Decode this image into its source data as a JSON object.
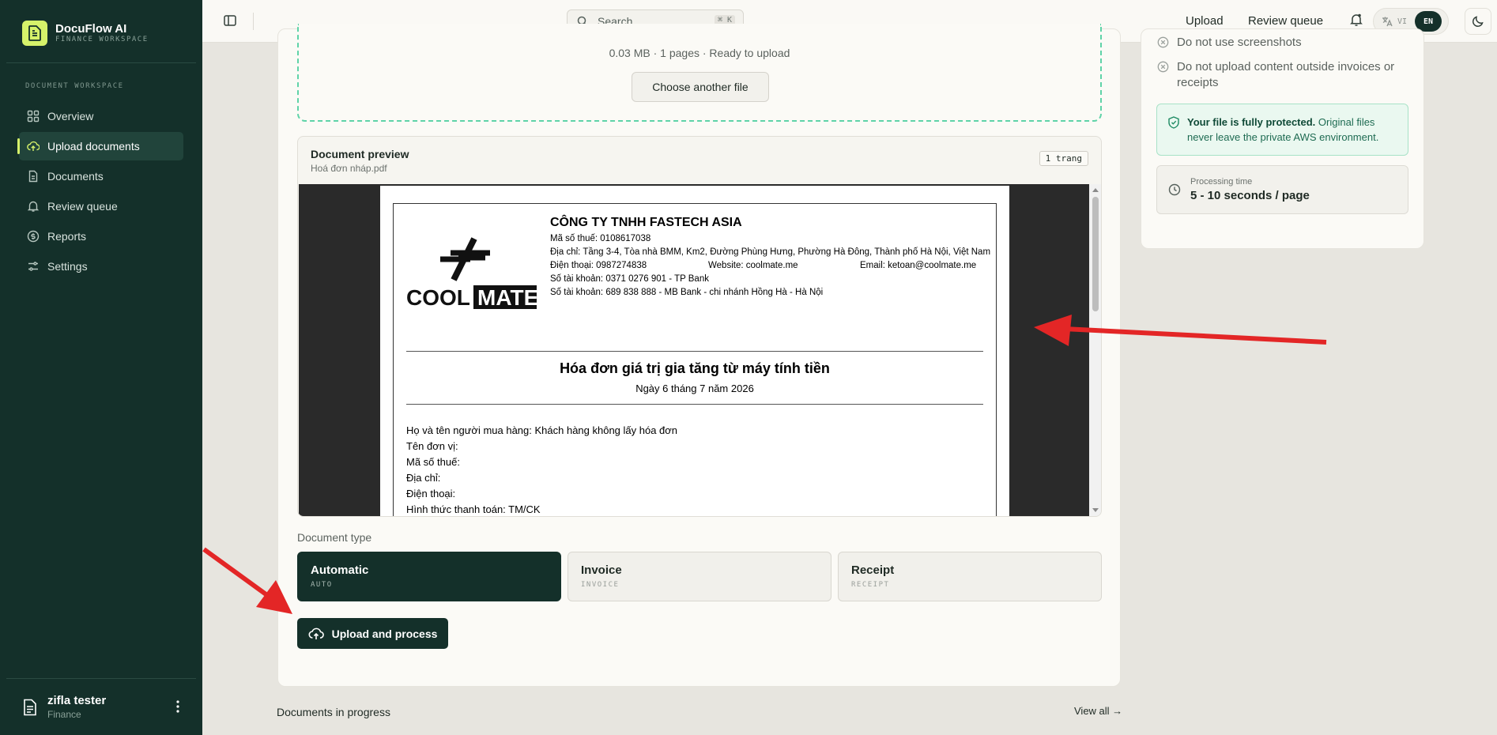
{
  "brand": {
    "name": "DocuFlow AI",
    "subtitle": "FINANCE WORKSPACE"
  },
  "sidebar": {
    "section_label": "DOCUMENT WORKSPACE",
    "items": [
      {
        "label": "Overview",
        "icon": "grid-icon"
      },
      {
        "label": "Upload documents",
        "icon": "cloud-upload-icon",
        "active": true
      },
      {
        "label": "Documents",
        "icon": "file-icon"
      },
      {
        "label": "Review queue",
        "icon": "bell-icon"
      },
      {
        "label": "Reports",
        "icon": "dollar-circle-icon"
      },
      {
        "label": "Settings",
        "icon": "sliders-icon"
      }
    ],
    "user": {
      "name": "zifla tester",
      "role": "Finance"
    }
  },
  "topbar": {
    "search_placeholder": "Search...",
    "search_shortcut": "⌘ K",
    "links": [
      "Upload",
      "Review queue"
    ],
    "lang_vi": "VI",
    "lang_en": "EN"
  },
  "upload": {
    "file_meta": "0.03 MB · 1 pages · Ready to upload",
    "choose_another": "Choose another file"
  },
  "preview": {
    "title": "Document preview",
    "filename": "Hoá đơn nháp.pdf",
    "page_count": "1 trang"
  },
  "invoice": {
    "logo_text": "COOL",
    "logo_text_boxed": "MATE",
    "company_name": "CÔNG TY TNHH FASTECH ASIA",
    "tax_code": "Mã số thuế: 0108617038",
    "address": "Địa chỉ: Tầng 3-4, Tòa nhà BMM, Km2, Đường Phùng Hưng, Phường Hà Đông, Thành phố Hà Nội, Việt Nam",
    "phone": "Điện thoại: 0987274838",
    "website": "Website: coolmate.me",
    "email": "Email: ketoan@coolmate.me",
    "account1": "Số tài khoản: 0371 0276 901 - TP Bank",
    "account2": "Số tài khoản: 689 838 888 - MB Bank - chi nhánh Hồng Hà - Hà Nội",
    "title": "Hóa đơn giá trị gia tăng từ máy tính tiền",
    "date": "Ngày 6 tháng 7 năm 2026",
    "buyer_lines": [
      "Họ và tên người mua hàng: Khách hàng không lấy hóa đơn",
      "Tên đơn vị:",
      "Mã số thuế:",
      "Địa chỉ:",
      "Điện thoại:",
      "Hình thức thanh toán: TM/CK"
    ]
  },
  "document_type": {
    "label": "Document type",
    "options": [
      {
        "title": "Automatic",
        "code": "AUTO",
        "selected": true
      },
      {
        "title": "Invoice",
        "code": "INVOICE"
      },
      {
        "title": "Receipt",
        "code": "RECEIPT"
      }
    ]
  },
  "upload_button": "Upload and process",
  "in_progress": {
    "title": "Documents in progress",
    "view_all": "View all →"
  },
  "rules": [
    "Do not use screenshots",
    "Do not upload content outside invoices or receipts"
  ],
  "protection": {
    "bold": "Your file is fully protected.",
    "text": " Original files never leave the private AWS environment."
  },
  "processing": {
    "label": "Processing time",
    "value": "5 - 10 seconds / page"
  },
  "colors": {
    "sidebar": "#14302a",
    "accent": "#d6f26a",
    "annotation_arrow": "#e32626"
  }
}
